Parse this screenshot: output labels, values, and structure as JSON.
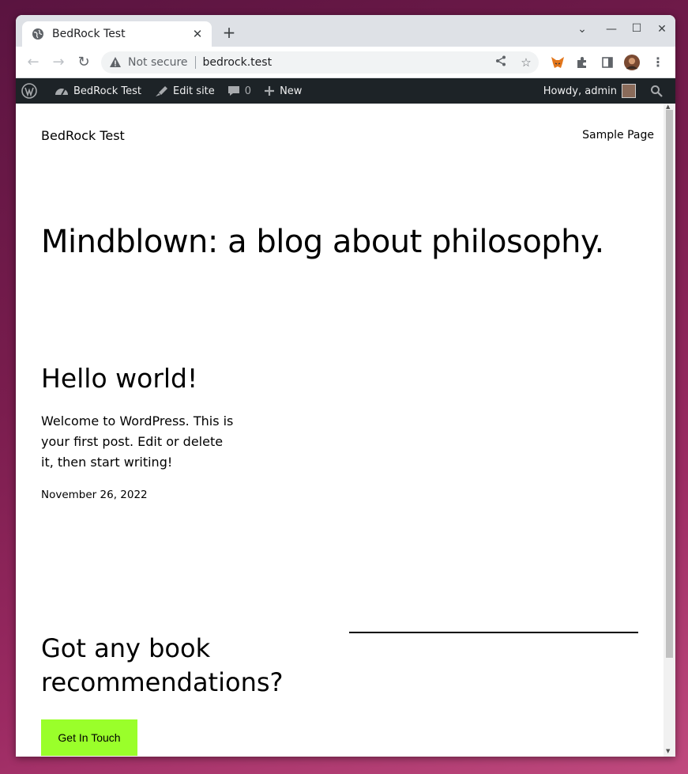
{
  "browser": {
    "tab_title": "BedRock Test",
    "new_tab_label": "+",
    "omnibox": {
      "security_label": "Not secure",
      "url": "bedrock.test"
    }
  },
  "admin_bar": {
    "site_name": "BedRock Test",
    "edit_site": "Edit site",
    "comments_count": "0",
    "new_label": "New",
    "howdy": "Howdy, admin"
  },
  "site": {
    "title": "BedRock Test",
    "nav": [
      "Sample Page"
    ],
    "hero": "Mindblown: a blog about philosophy.",
    "post": {
      "title": "Hello world!",
      "excerpt": "Welcome to WordPress. This is your first post. Edit or delete it, then start writing!",
      "date": "November 26, 2022"
    },
    "cta": {
      "title": "Got any book recommendations?",
      "button": "Get In Touch"
    }
  },
  "colors": {
    "admin_bar_bg": "#1d2327",
    "cta_button_bg": "#9aff2a",
    "tab_strip_bg": "#dee1e6"
  }
}
